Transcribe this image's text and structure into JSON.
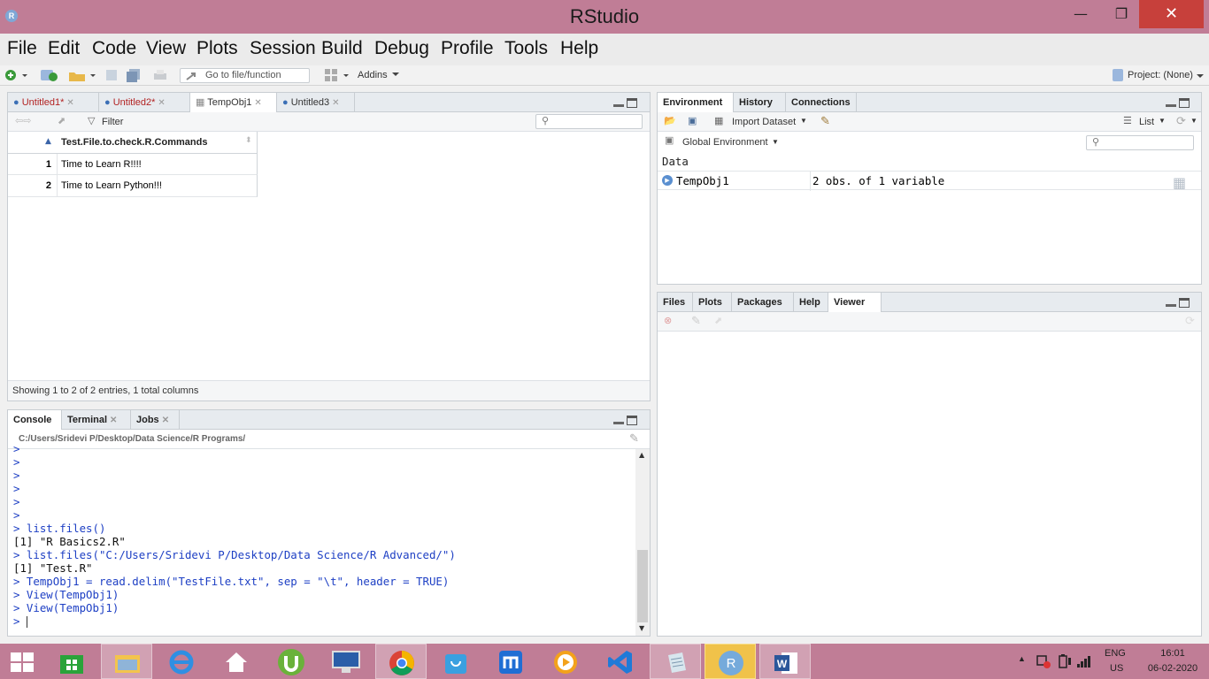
{
  "window": {
    "title": "RStudio",
    "app_icon": "R",
    "min": "—",
    "max": "❐",
    "close": "✕"
  },
  "menu": [
    "File",
    "Edit",
    "Code",
    "View",
    "Plots",
    "Session",
    "Build",
    "Debug",
    "Profile",
    "Tools",
    "Help"
  ],
  "toolbar": {
    "goto_placeholder": "Go to file/function",
    "addins": "Addins",
    "project": "Project: (None)"
  },
  "source": {
    "tabs": [
      {
        "label": "Untitled1*",
        "modified": true
      },
      {
        "label": "Untitled2*",
        "modified": true
      },
      {
        "label": "TempObj1",
        "modified": false
      },
      {
        "label": "Untitled3",
        "modified": false
      }
    ],
    "filter_label": "Filter",
    "column_header": "Test.File.to.check.R.Commands",
    "rows": [
      {
        "n": "1",
        "value": "Time to Learn R!!!!"
      },
      {
        "n": "2",
        "value": "Time to Learn Python!!!"
      }
    ],
    "status": "Showing 1 to 2 of 2 entries, 1 total columns"
  },
  "console": {
    "tabs": [
      "Console",
      "Terminal",
      "Jobs"
    ],
    "path": "C:/Users/Sridevi P/Desktop/Data Science/R Programs/",
    "lines": [
      {
        "t": ">",
        "c": "cmd"
      },
      {
        "t": ">",
        "c": "cmd"
      },
      {
        "t": ">",
        "c": "cmd"
      },
      {
        "t": ">",
        "c": "cmd"
      },
      {
        "t": ">",
        "c": "cmd"
      },
      {
        "t": ">",
        "c": "cmd"
      },
      {
        "t": "> list.files()",
        "c": "cmd"
      },
      {
        "t": "[1] \"R Basics2.R\"",
        "c": "out"
      },
      {
        "t": "> list.files(\"C:/Users/Sridevi P/Desktop/Data Science/R Advanced/\")",
        "c": "cmd"
      },
      {
        "t": "[1] \"Test.R\"",
        "c": "out"
      },
      {
        "t": "> TempObj1 = read.delim(\"TestFile.txt\", sep = \"\\t\", header = TRUE)",
        "c": "cmd"
      },
      {
        "t": "> View(TempObj1)",
        "c": "cmd"
      },
      {
        "t": "> View(TempObj1)",
        "c": "cmd"
      },
      {
        "t": "> ",
        "c": "cmd"
      }
    ]
  },
  "environment": {
    "tabs": [
      "Environment",
      "History",
      "Connections"
    ],
    "import_label": "Import Dataset",
    "list_label": "List",
    "scope": "Global Environment",
    "section": "Data",
    "items": [
      {
        "name": "TempObj1",
        "desc": "2 obs. of 1 variable"
      }
    ]
  },
  "files": {
    "tabs": [
      "Files",
      "Plots",
      "Packages",
      "Help",
      "Viewer"
    ]
  },
  "taskbar": {
    "lang": "ENG",
    "region": "US",
    "time": "16:01",
    "date": "06-02-2020"
  },
  "colors": {
    "accent": "#c07d96",
    "console_blue": "#1d3fc4",
    "modified_red": "#b22222"
  }
}
